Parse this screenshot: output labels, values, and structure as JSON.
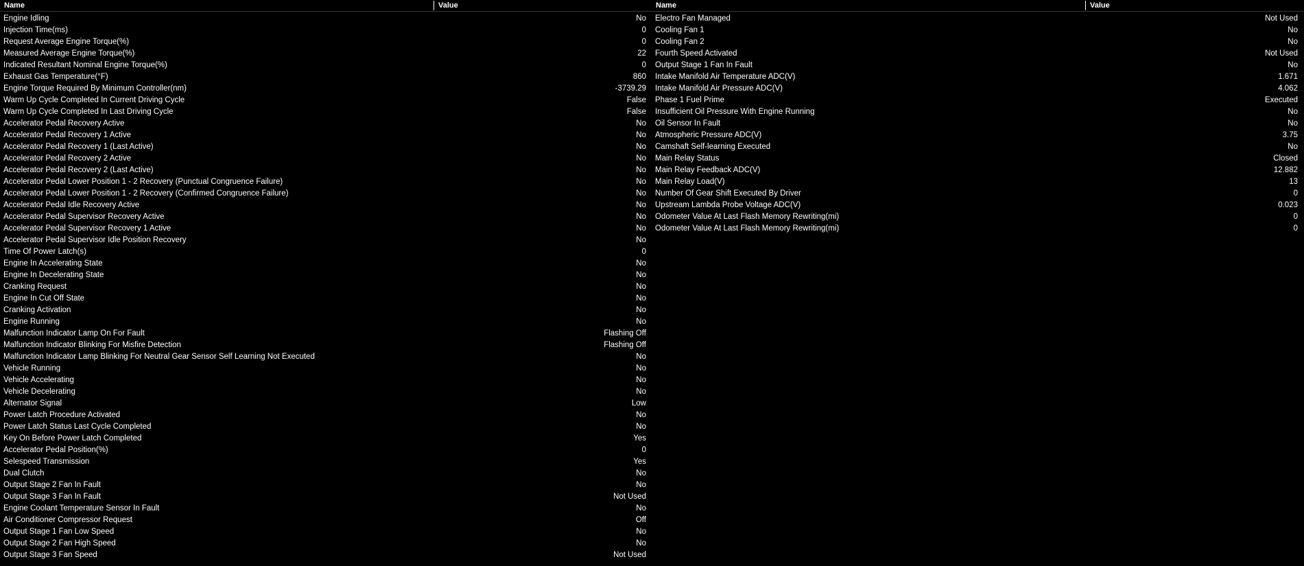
{
  "headers": {
    "name": "Name",
    "value": "Value"
  },
  "left_rows": [
    {
      "name": "Engine Idling",
      "value": "No"
    },
    {
      "name": "Injection Time(ms)",
      "value": "0"
    },
    {
      "name": "Request Average Engine Torque(%)",
      "value": "0"
    },
    {
      "name": "Measured Average Engine Torque(%)",
      "value": "22"
    },
    {
      "name": "Indicated Resultant Nominal Engine Torque(%)",
      "value": "0"
    },
    {
      "name": "Exhaust Gas Temperature(°F)",
      "value": "860"
    },
    {
      "name": "Engine Torque Required By Minimum Controller(nm)",
      "value": "-3739.29"
    },
    {
      "name": "Warm Up Cycle Completed In Current Driving Cycle",
      "value": "False"
    },
    {
      "name": "Warm Up Cycle Completed In Last Driving Cycle",
      "value": "False"
    },
    {
      "name": "Accelerator Pedal Recovery Active",
      "value": "No"
    },
    {
      "name": "Accelerator Pedal Recovery 1 Active",
      "value": "No"
    },
    {
      "name": "Accelerator Pedal Recovery 1 (Last Active)",
      "value": "No"
    },
    {
      "name": "Accelerator Pedal Recovery 2 Active",
      "value": "No"
    },
    {
      "name": "Accelerator Pedal Recovery 2 (Last Active)",
      "value": "No"
    },
    {
      "name": "Accelerator Pedal Lower Position 1 - 2 Recovery (Punctual Congruence Failure)",
      "value": "No"
    },
    {
      "name": "Accelerator Pedal Lower Position 1 - 2 Recovery (Confirmed Congruence Failure)",
      "value": "No"
    },
    {
      "name": "Accelerator Pedal Idle Recovery Active",
      "value": "No"
    },
    {
      "name": "Accelerator Pedal Supervisor Recovery Active",
      "value": "No"
    },
    {
      "name": "Accelerator Pedal Supervisor Recovery 1 Active",
      "value": "No"
    },
    {
      "name": "Accelerator Pedal Supervisor Idle Position Recovery",
      "value": "No"
    },
    {
      "name": "Time Of Power Latch(s)",
      "value": "0"
    },
    {
      "name": "Engine In Accelerating State",
      "value": "No"
    },
    {
      "name": "Engine In Decelerating State",
      "value": "No"
    },
    {
      "name": "Cranking Request",
      "value": "No"
    },
    {
      "name": "Engine In Cut Off State",
      "value": "No"
    },
    {
      "name": "Cranking Activation",
      "value": "No"
    },
    {
      "name": "Engine Running",
      "value": "No"
    },
    {
      "name": "Malfunction Indicator Lamp On For Fault",
      "value": "Flashing Off"
    },
    {
      "name": "Malfunction Indicator Blinking For Misfire Detection",
      "value": "Flashing Off"
    },
    {
      "name": "Malfunction Indicator Lamp Blinking For Neutral Gear Sensor Self Learning Not Executed",
      "value": "No"
    },
    {
      "name": "Vehicle Running",
      "value": "No"
    },
    {
      "name": "Vehicle Accelerating",
      "value": "No"
    },
    {
      "name": "Vehicle Decelerating",
      "value": "No"
    },
    {
      "name": "Alternator Signal",
      "value": "Low"
    },
    {
      "name": "Power Latch Procedure Activated",
      "value": "No"
    },
    {
      "name": "Power Latch Status Last Cycle Completed",
      "value": "No"
    },
    {
      "name": "Key On Before Power Latch Completed",
      "value": "Yes"
    },
    {
      "name": "Accelerator Pedal Position(%)",
      "value": "0"
    },
    {
      "name": "Selespeed Transmission",
      "value": "Yes"
    },
    {
      "name": "Dual Clutch",
      "value": "No"
    },
    {
      "name": "Output Stage 2 Fan In Fault",
      "value": "No"
    },
    {
      "name": "Output Stage 3 Fan In Fault",
      "value": "Not Used"
    },
    {
      "name": "Engine Coolant Temperature Sensor In Fault",
      "value": "No"
    },
    {
      "name": "Air Conditioner Compressor Request",
      "value": "Off"
    },
    {
      "name": "Output Stage 1 Fan Low Speed",
      "value": "No"
    },
    {
      "name": "Output Stage 2 Fan High Speed",
      "value": "No"
    },
    {
      "name": "Output Stage 3 Fan Speed",
      "value": "Not Used"
    }
  ],
  "right_rows": [
    {
      "name": "Electro Fan Managed",
      "value": "Not Used"
    },
    {
      "name": "Cooling Fan 1",
      "value": "No"
    },
    {
      "name": "Cooling Fan 2",
      "value": "No"
    },
    {
      "name": "Fourth Speed Activated",
      "value": "Not Used"
    },
    {
      "name": "Output Stage 1 Fan In Fault",
      "value": "No"
    },
    {
      "name": "Intake Manifold Air Temperature ADC(V)",
      "value": "1.671"
    },
    {
      "name": "Intake Manifold Air Pressure ADC(V)",
      "value": "4.062"
    },
    {
      "name": "Phase 1 Fuel Prime",
      "value": "Executed"
    },
    {
      "name": "Insufficient Oil Pressure With Engine Running",
      "value": "No"
    },
    {
      "name": "Oil Sensor In Fault",
      "value": "No"
    },
    {
      "name": "Atmospheric Pressure ADC(V)",
      "value": "3.75"
    },
    {
      "name": "Camshaft Self-learning Executed",
      "value": "No"
    },
    {
      "name": "Main Relay Status",
      "value": "Closed"
    },
    {
      "name": "Main Relay Feedback ADC(V)",
      "value": "12.882"
    },
    {
      "name": "Main Relay Load(V)",
      "value": "13"
    },
    {
      "name": "Number Of Gear Shift Executed By Driver",
      "value": "0"
    },
    {
      "name": "Upstream Lambda Probe Voltage ADC(V)",
      "value": "0.023"
    },
    {
      "name": "Odometer Value At Last Flash Memory Rewriting(mi)",
      "value": "0"
    },
    {
      "name": "Odometer Value At Last Flash Memory Rewriting(mi)",
      "value": "0"
    }
  ]
}
